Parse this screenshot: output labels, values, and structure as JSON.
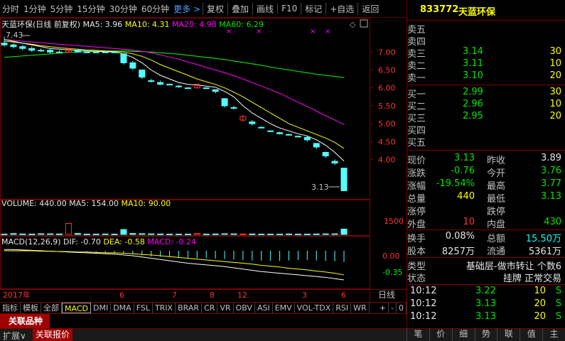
{
  "toolbar": {
    "items": [
      "分时",
      "1分钟",
      "5分钟",
      "15分钟",
      "30分钟",
      "60分钟"
    ],
    "more": "更多 >",
    "buttons": [
      "复权",
      "叠加",
      "画线",
      "F10",
      "标记",
      "+自选",
      "返回"
    ]
  },
  "kline": {
    "title": "天蓝环保(日线 前复权)",
    "ma5": "MA5: 3.96",
    "ma10": "MA10: 4.31",
    "ma20": "MA20: 4.98",
    "ma60": "MA60: 6.29",
    "high_label": "7.43",
    "last_label": "3.13",
    "y_ticks": [
      "7.00",
      "6.50",
      "6.00",
      "5.50",
      "5.00",
      "4.50",
      "4.00"
    ],
    "y_values": [
      7.0,
      6.5,
      6.0,
      5.5,
      5.0,
      4.5,
      4.0
    ],
    "ylim": [
      3.0,
      7.6
    ]
  },
  "volume": {
    "label": "VOLUME: 440.00",
    "ma5": "MA5: 154.00",
    "ma10": "MA10: 90.00",
    "y_tick": "1500",
    "y_max": 2500
  },
  "macd": {
    "label": "MACD(12,26,9)",
    "dif": "DIF: -0.70",
    "dea": "DEA: -0.58",
    "macd": "MACD: -0.24",
    "y_ticks": [
      "0.00",
      "-0.35"
    ]
  },
  "date_axis": {
    "year": "2017年",
    "months": [
      "6",
      "7",
      "8",
      "12",
      "3",
      "6"
    ],
    "mode": "日线"
  },
  "chart_data": {
    "type": "candlestick",
    "title": "天蓝环保(日线 前复权)",
    "candles": [
      {
        "o": 7.25,
        "c": 7.2,
        "h": 7.43,
        "l": 7.15
      },
      {
        "o": 7.2,
        "c": 7.15,
        "h": 7.25,
        "l": 7.1
      },
      {
        "o": 7.15,
        "c": 7.1,
        "h": 7.2,
        "l": 7.05
      },
      {
        "o": 7.1,
        "c": 7.05,
        "h": 7.15,
        "l": 7.0
      },
      {
        "o": 7.05,
        "c": 7.05,
        "h": 7.1,
        "l": 7.0
      },
      {
        "o": 7.05,
        "c": 7.0,
        "h": 7.1,
        "l": 6.95
      },
      {
        "o": 7.0,
        "c": 7.0,
        "h": 7.05,
        "l": 6.98
      },
      {
        "o": 7.0,
        "c": 7.08,
        "h": 7.12,
        "l": 6.98
      },
      {
        "o": 7.05,
        "c": 7.0,
        "h": 7.08,
        "l": 6.98
      },
      {
        "o": 7.0,
        "c": 7.0,
        "h": 7.02,
        "l": 6.98
      },
      {
        "o": 7.0,
        "c": 7.0,
        "h": 7.02,
        "l": 6.98
      },
      {
        "o": 7.0,
        "c": 7.0,
        "h": 7.02,
        "l": 6.98
      },
      {
        "o": 7.0,
        "c": 7.0,
        "h": 7.02,
        "l": 6.98
      },
      {
        "o": 6.95,
        "c": 6.7,
        "h": 6.95,
        "l": 6.65
      },
      {
        "o": 6.7,
        "c": 6.55,
        "h": 6.75,
        "l": 6.5
      },
      {
        "o": 6.5,
        "c": 6.3,
        "h": 6.5,
        "l": 6.25
      },
      {
        "o": 6.2,
        "c": 6.2,
        "h": 6.25,
        "l": 6.15
      },
      {
        "o": 6.15,
        "c": 6.1,
        "h": 6.2,
        "l": 6.08
      },
      {
        "o": 6.1,
        "c": 6.1,
        "h": 6.12,
        "l": 6.08
      },
      {
        "o": 6.05,
        "c": 6.05,
        "h": 6.08,
        "l": 6.0
      },
      {
        "o": 6.0,
        "c": 6.0,
        "h": 6.02,
        "l": 5.98
      },
      {
        "o": 6.0,
        "c": 6.1,
        "h": 6.1,
        "l": 5.98
      },
      {
        "o": 6.0,
        "c": 6.0,
        "h": 6.02,
        "l": 5.98
      },
      {
        "o": 5.95,
        "c": 5.9,
        "h": 5.95,
        "l": 5.85
      },
      {
        "o": 5.7,
        "c": 5.5,
        "h": 5.7,
        "l": 5.45
      },
      {
        "o": 5.45,
        "c": 5.45,
        "h": 5.5,
        "l": 5.4
      },
      {
        "o": 5.1,
        "c": 5.2,
        "h": 5.25,
        "l": 5.05
      },
      {
        "o": 5.05,
        "c": 5.0,
        "h": 5.1,
        "l": 4.95
      },
      {
        "o": 4.9,
        "c": 4.9,
        "h": 4.92,
        "l": 4.88
      },
      {
        "o": 4.8,
        "c": 4.8,
        "h": 4.82,
        "l": 4.78
      },
      {
        "o": 4.75,
        "c": 4.72,
        "h": 4.78,
        "l": 4.7
      },
      {
        "o": 4.7,
        "c": 4.7,
        "h": 4.72,
        "l": 4.68
      },
      {
        "o": 4.65,
        "c": 4.65,
        "h": 4.67,
        "l": 4.63
      },
      {
        "o": 4.62,
        "c": 4.55,
        "h": 4.65,
        "l": 4.5
      },
      {
        "o": 4.45,
        "c": 4.35,
        "h": 4.45,
        "l": 4.3
      },
      {
        "o": 4.2,
        "c": 4.1,
        "h": 4.22,
        "l": 4.05
      },
      {
        "o": 3.95,
        "c": 3.9,
        "h": 4.0,
        "l": 3.85
      },
      {
        "o": 3.76,
        "c": 3.13,
        "h": 3.77,
        "l": 3.13
      }
    ],
    "ma5": [
      7.35,
      7.3,
      7.25,
      7.2,
      7.15,
      7.1,
      7.08,
      7.06,
      7.05,
      7.03,
      7.02,
      7.01,
      7.0,
      6.95,
      6.85,
      6.7,
      6.5,
      6.35,
      6.25,
      6.15,
      6.1,
      6.08,
      6.05,
      6.02,
      5.9,
      5.75,
      5.5,
      5.3,
      5.15,
      5.0,
      4.88,
      4.8,
      4.72,
      4.66,
      4.55,
      4.4,
      4.2,
      3.96
    ],
    "ma10": [
      7.3,
      7.28,
      7.25,
      7.22,
      7.18,
      7.15,
      7.12,
      7.1,
      7.08,
      7.06,
      7.05,
      7.03,
      7.02,
      7.0,
      6.95,
      6.88,
      6.78,
      6.65,
      6.55,
      6.45,
      6.35,
      6.25,
      6.17,
      6.1,
      6.0,
      5.88,
      5.75,
      5.6,
      5.45,
      5.3,
      5.15,
      5.0,
      4.9,
      4.8,
      4.7,
      4.6,
      4.48,
      4.31
    ],
    "ma20": [
      7.35,
      7.33,
      7.3,
      7.28,
      7.26,
      7.24,
      7.22,
      7.2,
      7.18,
      7.16,
      7.14,
      7.12,
      7.1,
      7.08,
      7.05,
      7.02,
      6.98,
      6.92,
      6.86,
      6.8,
      6.72,
      6.65,
      6.57,
      6.5,
      6.42,
      6.34,
      6.25,
      6.15,
      6.05,
      5.95,
      5.85,
      5.72,
      5.6,
      5.48,
      5.35,
      5.22,
      5.1,
      4.98
    ],
    "ma60": [
      6.85,
      6.87,
      6.89,
      6.91,
      6.93,
      6.95,
      6.97,
      6.99,
      7.0,
      7.01,
      7.02,
      7.03,
      7.03,
      7.03,
      7.02,
      7.01,
      7.0,
      6.98,
      6.96,
      6.94,
      6.91,
      6.88,
      6.85,
      6.82,
      6.79,
      6.75,
      6.71,
      6.67,
      6.63,
      6.58,
      6.54,
      6.5,
      6.46,
      6.42,
      6.38,
      6.35,
      6.32,
      6.29
    ],
    "volume": [
      30,
      70,
      40,
      30,
      60,
      50,
      40,
      900,
      80,
      30,
      30,
      40,
      30,
      400,
      80,
      60,
      50,
      40,
      30,
      30,
      30,
      80,
      30,
      40,
      60,
      50,
      40,
      40,
      30,
      30,
      30,
      40,
      30,
      30,
      40,
      50,
      50,
      440
    ],
    "macd_hist": [
      0.02,
      0.03,
      0.03,
      0.02,
      0.02,
      0.01,
      0.01,
      0.0,
      0.0,
      -0.01,
      -0.02,
      -0.03,
      -0.04,
      -0.06,
      -0.08,
      -0.1,
      -0.12,
      -0.13,
      -0.14,
      -0.15,
      -0.15,
      -0.16,
      -0.16,
      -0.17,
      -0.18,
      -0.19,
      -0.2,
      -0.21,
      -0.22,
      -0.22,
      -0.22,
      -0.21,
      -0.2,
      -0.2,
      -0.21,
      -0.22,
      -0.23,
      -0.24
    ],
    "dif": [
      0.03,
      0.03,
      0.02,
      0.01,
      0.0,
      -0.01,
      -0.02,
      -0.03,
      -0.04,
      -0.05,
      -0.06,
      -0.07,
      -0.08,
      -0.1,
      -0.12,
      -0.15,
      -0.18,
      -0.21,
      -0.24,
      -0.27,
      -0.3,
      -0.32,
      -0.34,
      -0.36,
      -0.38,
      -0.41,
      -0.44,
      -0.47,
      -0.5,
      -0.52,
      -0.54,
      -0.56,
      -0.58,
      -0.6,
      -0.62,
      -0.64,
      -0.67,
      -0.7
    ],
    "dea": [
      0.0,
      0.0,
      0.0,
      0.0,
      -0.01,
      -0.01,
      -0.02,
      -0.02,
      -0.03,
      -0.03,
      -0.04,
      -0.05,
      -0.05,
      -0.06,
      -0.07,
      -0.09,
      -0.1,
      -0.12,
      -0.14,
      -0.16,
      -0.18,
      -0.2,
      -0.22,
      -0.24,
      -0.26,
      -0.28,
      -0.3,
      -0.32,
      -0.35,
      -0.37,
      -0.39,
      -0.42,
      -0.44,
      -0.46,
      -0.49,
      -0.51,
      -0.54,
      -0.58
    ],
    "ylim": [
      3.0,
      7.6
    ]
  },
  "quote": {
    "code": "833772",
    "name": "天蓝环保",
    "asks": [
      {
        "label": "卖五",
        "price": "",
        "vol": ""
      },
      {
        "label": "卖四",
        "price": "",
        "vol": ""
      },
      {
        "label": "卖三",
        "price": "3.14",
        "vol": "30"
      },
      {
        "label": "卖二",
        "price": "3.11",
        "vol": "10"
      },
      {
        "label": "卖一",
        "price": "3.10",
        "vol": "20"
      }
    ],
    "bids": [
      {
        "label": "买一",
        "price": "2.99",
        "vol": "30"
      },
      {
        "label": "买二",
        "price": "2.96",
        "vol": "10"
      },
      {
        "label": "买三",
        "price": "2.95",
        "vol": "20"
      },
      {
        "label": "买四",
        "price": "",
        "vol": ""
      },
      {
        "label": "买五",
        "price": "",
        "vol": ""
      }
    ],
    "stats": [
      {
        "l1": "现价",
        "v1": "3.13",
        "c1": "green",
        "l2": "昨收",
        "v2": "3.89",
        "c2": "white"
      },
      {
        "l1": "涨跌",
        "v1": "-0.76",
        "c1": "green",
        "l2": "今开",
        "v2": "3.76",
        "c2": "green"
      },
      {
        "l1": "涨幅",
        "v1": "-19.54%",
        "c1": "green",
        "l2": "最高",
        "v2": "3.77",
        "c2": "green"
      },
      {
        "l1": "总量",
        "v1": "440",
        "c1": "yellow",
        "l2": "最低",
        "v2": "3.13",
        "c2": "green"
      },
      {
        "l1": "涨停",
        "v1": "",
        "c1": "white",
        "l2": "跌停",
        "v2": "",
        "c2": "white"
      },
      {
        "l1": "外盘",
        "v1": "10",
        "c1": "red",
        "l2": "内盘",
        "v2": "430",
        "c2": "green"
      },
      {
        "l1": "换手",
        "v1": "0.08%",
        "c1": "white",
        "l2": "总额",
        "v2": "15.50万",
        "c2": "cyan"
      },
      {
        "l1": "股本",
        "v1": "8257万",
        "c1": "white",
        "l2": "流通",
        "v2": "5361万",
        "c2": "white"
      }
    ],
    "type_label": "类型",
    "type_value": "基础层-做市转让 个数6",
    "status_label": "状态",
    "status_value": "挂牌 正常交易",
    "ticks": [
      {
        "time": "10:12",
        "price": "3.22",
        "vol": "10",
        "side": "S"
      },
      {
        "time": "10:12",
        "price": "3.13",
        "vol": "20",
        "side": "S"
      },
      {
        "time": "10:12",
        "price": "3.13",
        "vol": "20",
        "side": "S"
      }
    ]
  },
  "tabs": [
    "指标",
    "模板",
    "全部",
    "MACD",
    "DMI",
    "DMA",
    "FSL",
    "TRIX",
    "BRAR",
    "CR",
    "VR",
    "OBV",
    "ASI",
    "EMV",
    "VOL-TDX",
    "RSI",
    "WR"
  ],
  "tab_controls": [
    "+",
    "-",
    "0"
  ],
  "related": "关联品种",
  "bottom": {
    "expand": "扩展∨",
    "related_quote": "关联报价"
  },
  "right_tabs": [
    "笔",
    "价",
    "细",
    "势",
    "联",
    "值",
    "主"
  ],
  "colors": {
    "up": "#ff3232",
    "down": "#54ffff",
    "ma5": "#ffffff",
    "ma10": "#ffff00",
    "ma20": "#ff00ff",
    "ma60": "#00ff00"
  }
}
